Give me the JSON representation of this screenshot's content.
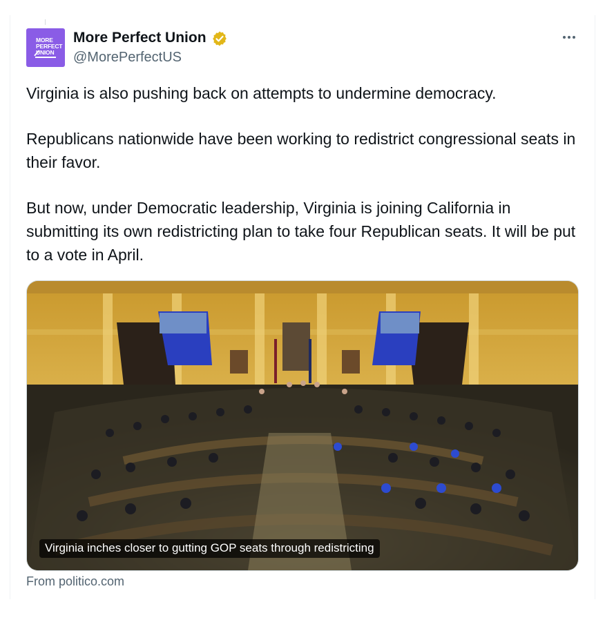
{
  "author": {
    "display_name": "More Perfect Union",
    "handle": "@MorePerfectUS",
    "avatar_lines": [
      "MORE",
      "PERFECT",
      "UNION"
    ],
    "avatar_color": "#8a5ce6",
    "verified_color": "#e2b719"
  },
  "tweet": {
    "paragraphs": [
      "Virginia is also pushing back on attempts to undermine democracy.",
      "Republicans nationwide have been working to redistrict congressional seats in their favor.",
      "But now, under Democratic leadership, Virginia is joining California in submitting its own redistricting plan to take four Republican seats. It will be put to a vote in April."
    ]
  },
  "link_card": {
    "headline": "Virginia inches closer to gutting GOP seats through redistricting",
    "source": "From politico.com",
    "image_subject": "photo-virginia-house-chamber"
  },
  "icons": {
    "more": "more-options-icon",
    "verified": "verified-badge-icon"
  },
  "colors": {
    "text": "#0f1419",
    "secondary": "#536471",
    "border": "#cfd9de"
  }
}
